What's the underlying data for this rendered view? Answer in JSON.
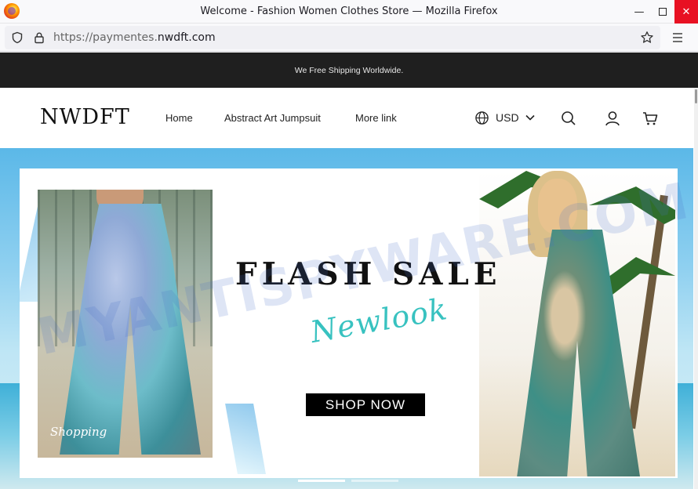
{
  "window": {
    "title": "Welcome - Fashion Women Clothes Store — Mozilla Firefox",
    "minimize_glyph": "—",
    "close_glyph": "✕"
  },
  "addressbar": {
    "scheme_prefix": "https://paymentes.",
    "domain": "nwdft.com"
  },
  "store": {
    "announcement": "We Free Shipping Worldwide.",
    "logo": "NWDFT",
    "nav": [
      {
        "label": "Home"
      },
      {
        "label": "Abstract Art Jumpsuit"
      },
      {
        "label": "More link"
      }
    ],
    "currency": "USD"
  },
  "hero": {
    "headline": "FLASH SALE",
    "script_text": "Newlook",
    "cta": "SHOP NOW",
    "photo_caption": "Shopping",
    "watermark": "MYANTISPYWARE.COM",
    "slides": [
      {
        "active": true
      },
      {
        "active": false
      }
    ]
  },
  "icons": [
    "firefox-logo",
    "shield-icon",
    "lock-icon",
    "star-icon",
    "hamburger-icon",
    "globe-icon",
    "chevron-down-icon",
    "search-icon",
    "user-icon",
    "cart-icon"
  ],
  "colors": {
    "announcement_bg": "#1f1f1f",
    "close_button": "#e81123",
    "cta_bg": "#000000",
    "script_text": "#38c2c0"
  }
}
